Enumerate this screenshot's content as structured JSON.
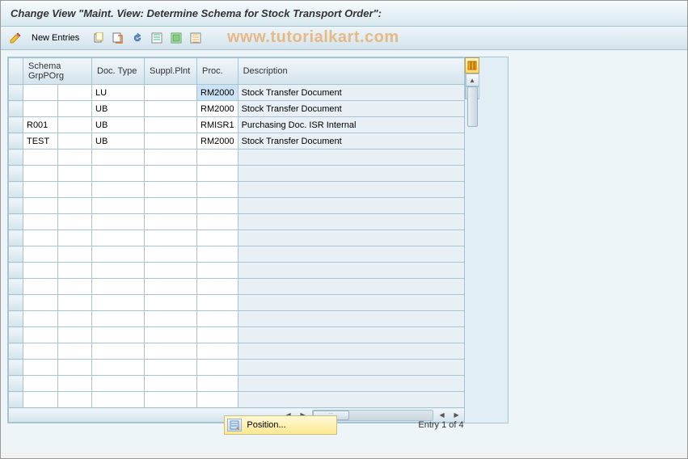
{
  "title": "Change View \"Maint. View: Determine Schema for Stock Transport Order\":",
  "watermark": "www.tutorialkart.com",
  "toolbar": {
    "new_entries_label": "New Entries"
  },
  "table": {
    "columns": {
      "schema_grp": "Schema Grp",
      "porg": "POrg",
      "doc_type": "Doc. Type",
      "suppl_plnt": "Suppl.Plnt",
      "proc": "Proc.",
      "description": "Description"
    },
    "rows": [
      {
        "schema_grp": "",
        "porg": "",
        "doc_type": "LU",
        "suppl_plnt": "",
        "proc": "RM2000",
        "description": "Stock Transfer Document",
        "proc_highlight": true
      },
      {
        "schema_grp": "",
        "porg": "",
        "doc_type": "UB",
        "suppl_plnt": "",
        "proc": "RM2000",
        "description": "Stock Transfer Document"
      },
      {
        "schema_grp": "R001",
        "porg": "",
        "doc_type": "UB",
        "suppl_plnt": "",
        "proc": "RMISR1",
        "description": "Purchasing Doc. ISR Internal"
      },
      {
        "schema_grp": "TEST",
        "porg": "",
        "doc_type": "UB",
        "suppl_plnt": "",
        "proc": "RM2000",
        "description": "Stock Transfer Document"
      }
    ],
    "empty_rows": 16
  },
  "footer": {
    "position_label": "Position...",
    "entry_label": "Entry 1 of 4"
  },
  "icons": {
    "pencil": "pencil-icon",
    "copy": "copy-icon",
    "paste": "paste-icon",
    "undo": "undo-icon",
    "select_all": "select-all-icon",
    "deselect": "deselect-icon",
    "config": "config-column-icon",
    "up": "▲",
    "down": "▼",
    "left": "◀",
    "right": "▶"
  }
}
